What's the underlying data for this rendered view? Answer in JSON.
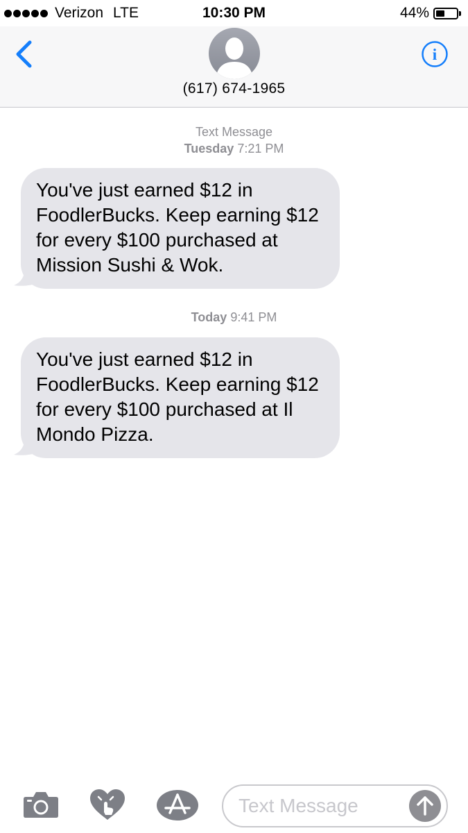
{
  "status_bar": {
    "carrier": "Verizon",
    "network": "LTE",
    "time": "10:30 PM",
    "battery_percent": "44%",
    "battery_level": 0.44
  },
  "header": {
    "contact": "(617) 674-1965",
    "back_icon": "chevron-left-icon",
    "info_icon": "info-icon"
  },
  "thread": {
    "service_label": "Text Message",
    "messages": [
      {
        "day": "Tuesday",
        "time": "7:21 PM",
        "text": "You've just earned $12 in FoodlerBucks.  Keep earning $12 for every $100 purchased at Mission Sushi & Wok."
      },
      {
        "day": "Today",
        "time": "9:41 PM",
        "text": "You've just earned $12 in FoodlerBucks.  Keep earning $12 for every $100 purchased at Il Mondo Pizza."
      }
    ]
  },
  "input_bar": {
    "placeholder": "Text Message",
    "icons": [
      "camera-icon",
      "digital-touch-icon",
      "app-store-icon",
      "send-arrow-icon"
    ]
  },
  "colors": {
    "accent": "#147efb",
    "bubble": "#e5e5ea",
    "secondary_text": "#8e8e93"
  }
}
